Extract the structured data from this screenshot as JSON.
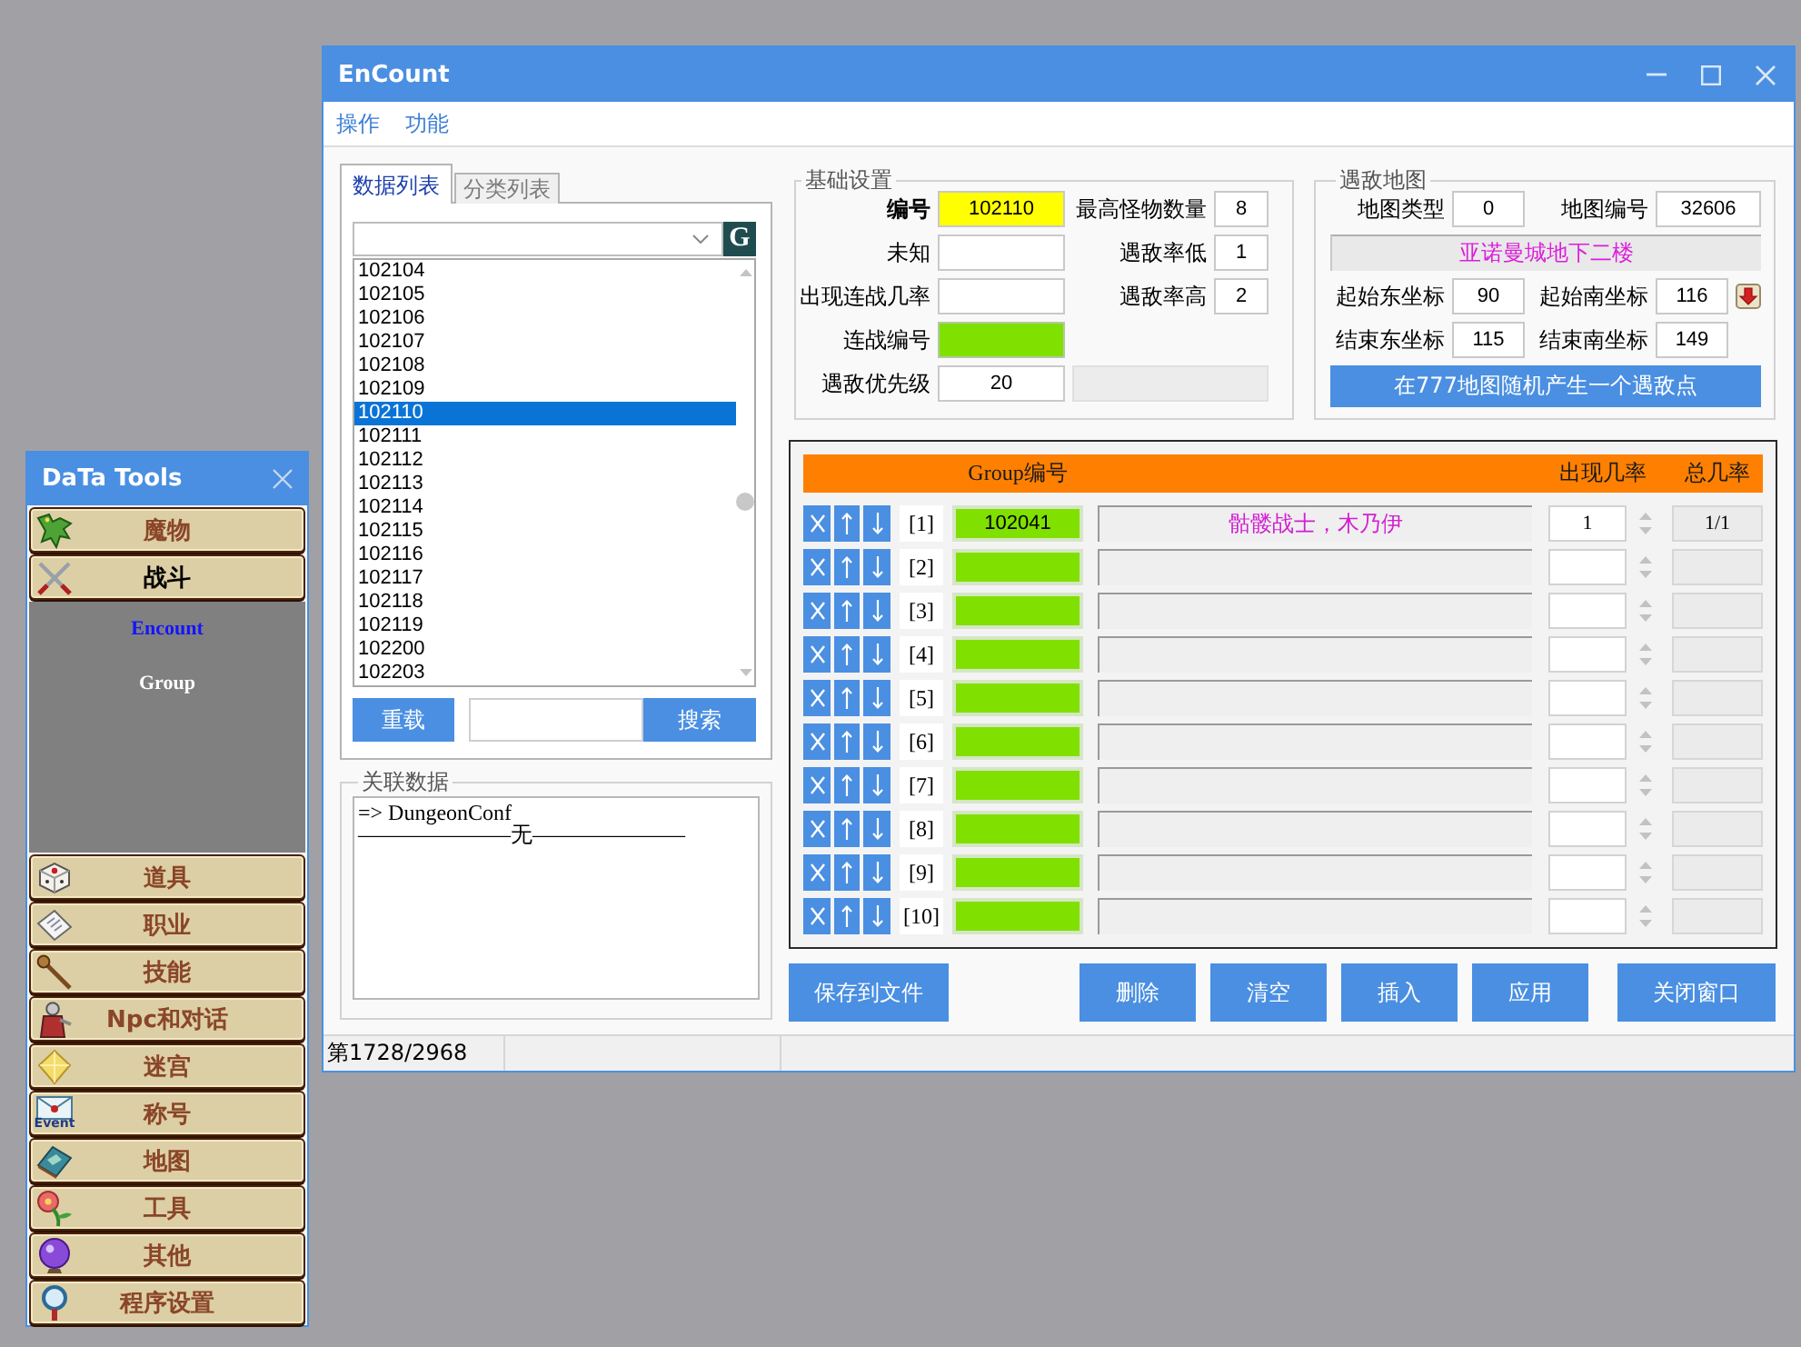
{
  "encount_window": {
    "title": "EnCount",
    "menu": [
      "操作",
      "功能"
    ],
    "list_tabs": [
      {
        "label": "数据列表",
        "selected": true
      },
      {
        "label": "分类列表",
        "selected": false
      }
    ],
    "combo_button": "G",
    "records": [
      {
        "label": "102104",
        "selected": false
      },
      {
        "label": "102105",
        "selected": false
      },
      {
        "label": "102106",
        "selected": false
      },
      {
        "label": "102107",
        "selected": false
      },
      {
        "label": "102108",
        "selected": false
      },
      {
        "label": "102109",
        "selected": false
      },
      {
        "label": "102110",
        "selected": true
      },
      {
        "label": "102111",
        "selected": false
      },
      {
        "label": "102112",
        "selected": false
      },
      {
        "label": "102113",
        "selected": false
      },
      {
        "label": "102114",
        "selected": false
      },
      {
        "label": "102115",
        "selected": false
      },
      {
        "label": "102116",
        "selected": false
      },
      {
        "label": "102117",
        "selected": false
      },
      {
        "label": "102118",
        "selected": false
      },
      {
        "label": "102119",
        "selected": false
      },
      {
        "label": "102200",
        "selected": false
      },
      {
        "label": "102203",
        "selected": false
      }
    ],
    "reload_button": "重载",
    "search_button": "搜索",
    "related": {
      "title": "关联数据",
      "lines": [
        "=> DungeonConf",
        "———————无———————"
      ]
    },
    "basic": {
      "title": "基础设置",
      "rows": [
        {
          "left": {
            "label": "编号",
            "value": "102110",
            "kind": "key"
          },
          "right": {
            "label": "最高怪物数量",
            "value": "8",
            "kind": "text"
          }
        },
        {
          "left": {
            "label": "未知",
            "kind": "text"
          },
          "right": {
            "label": "遇敌率低",
            "value": "1",
            "kind": "text"
          }
        },
        {
          "left": {
            "label": "出现连战几率",
            "kind": "text"
          },
          "right": {
            "label": "遇敌率高",
            "value": "2",
            "kind": "text"
          }
        },
        {
          "left": {
            "label": "连战编号",
            "kind": "ref"
          }
        },
        {
          "left": {
            "label": "遇敌优先级",
            "value": "20",
            "kind": "text"
          },
          "right": {
            "kind": "wide",
            "disabled": true
          }
        }
      ]
    },
    "map": {
      "title": "遇敌地图",
      "fields": [
        {
          "label": "地图类型",
          "value": "0"
        },
        {
          "label": "地图编号",
          "value": "32606"
        }
      ],
      "map_name": "亚诺曼城地下二楼",
      "coords": [
        {
          "label": "起始东坐标",
          "value": "90"
        },
        {
          "label": "起始南坐标",
          "value": "116"
        },
        {
          "label": "结束东坐标",
          "value": "115"
        },
        {
          "label": "结束南坐标",
          "value": "149"
        }
      ],
      "random_button": "在777地图随机产生一个遇敌点"
    },
    "groups": {
      "columns": [
        "Group编号",
        "出现几率",
        "总几率"
      ],
      "rows": [
        {
          "index": "[1]",
          "group_id": "102041",
          "name": "骷髅战士，木乃伊",
          "rate": "1",
          "total": "1/1"
        },
        {
          "index": "[2]"
        },
        {
          "index": "[3]"
        },
        {
          "index": "[4]"
        },
        {
          "index": "[5]"
        },
        {
          "index": "[6]"
        },
        {
          "index": "[7]"
        },
        {
          "index": "[8]"
        },
        {
          "index": "[9]"
        },
        {
          "index": "[10]"
        }
      ]
    },
    "buttons": [
      "保存到文件",
      "删除",
      "清空",
      "插入",
      "应用",
      "关闭窗口"
    ],
    "status_bar": [
      "第1728/2968"
    ]
  },
  "tools_window": {
    "title": "DaTa Tools",
    "categories": [
      {
        "label": "魔物",
        "expanded": false
      },
      {
        "label": "战斗",
        "expanded": true,
        "children": [
          {
            "label": "Encount",
            "selected": true
          },
          {
            "label": "Group",
            "selected": false
          }
        ]
      },
      {
        "label": "道具",
        "expanded": false
      },
      {
        "label": "职业",
        "expanded": false
      },
      {
        "label": "技能",
        "expanded": false
      },
      {
        "label": "Npc和对话",
        "expanded": false
      },
      {
        "label": "迷宫",
        "expanded": false
      },
      {
        "label": "称号",
        "expanded": false,
        "icon_caption": "Event"
      },
      {
        "label": "地图",
        "expanded": false
      },
      {
        "label": "工具",
        "expanded": false
      },
      {
        "label": "其他",
        "expanded": false
      },
      {
        "label": "程序设置",
        "expanded": false
      }
    ]
  }
}
